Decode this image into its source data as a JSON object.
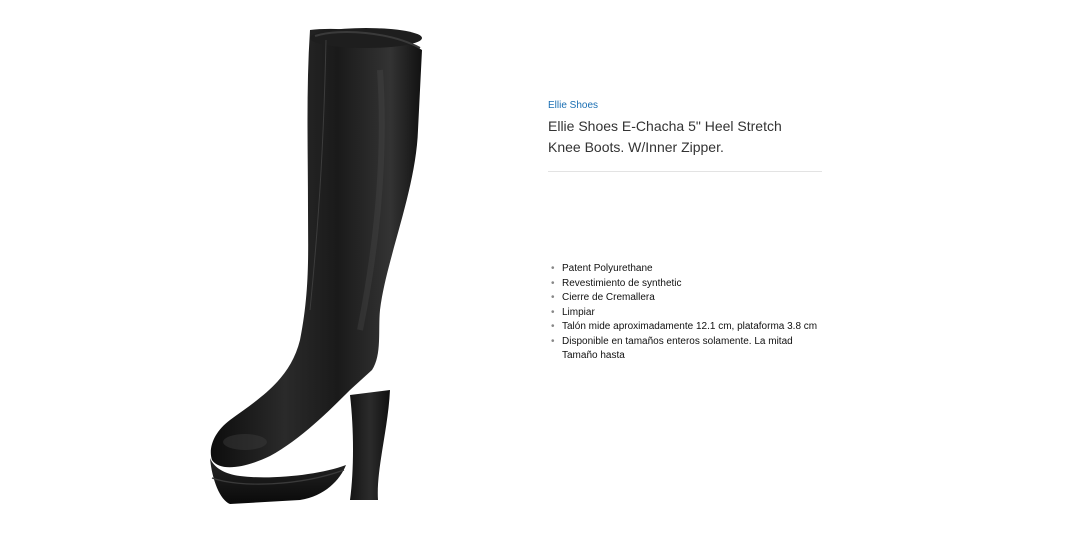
{
  "product": {
    "brand": "Ellie Shoes",
    "title": "Ellie Shoes E-Chacha 5\" Heel Stretch Knee Boots. W/Inner Zipper.",
    "image": {
      "description": "black-knee-high-platform-boot",
      "color": "#1c1c1c"
    },
    "features": [
      "Patent Polyurethane",
      "Revestimiento de synthetic",
      "Cierre de Cremallera",
      "Limpiar",
      "Talón mide aproximadamente 12.1 cm, plataforma 3.8 cm",
      "Disponible en tamaños enteros solamente. La mitad Tamaño hasta"
    ]
  },
  "colors": {
    "brand_link": "#1a6fb3",
    "title_text": "#333333",
    "divider": "#e3e3e3"
  }
}
